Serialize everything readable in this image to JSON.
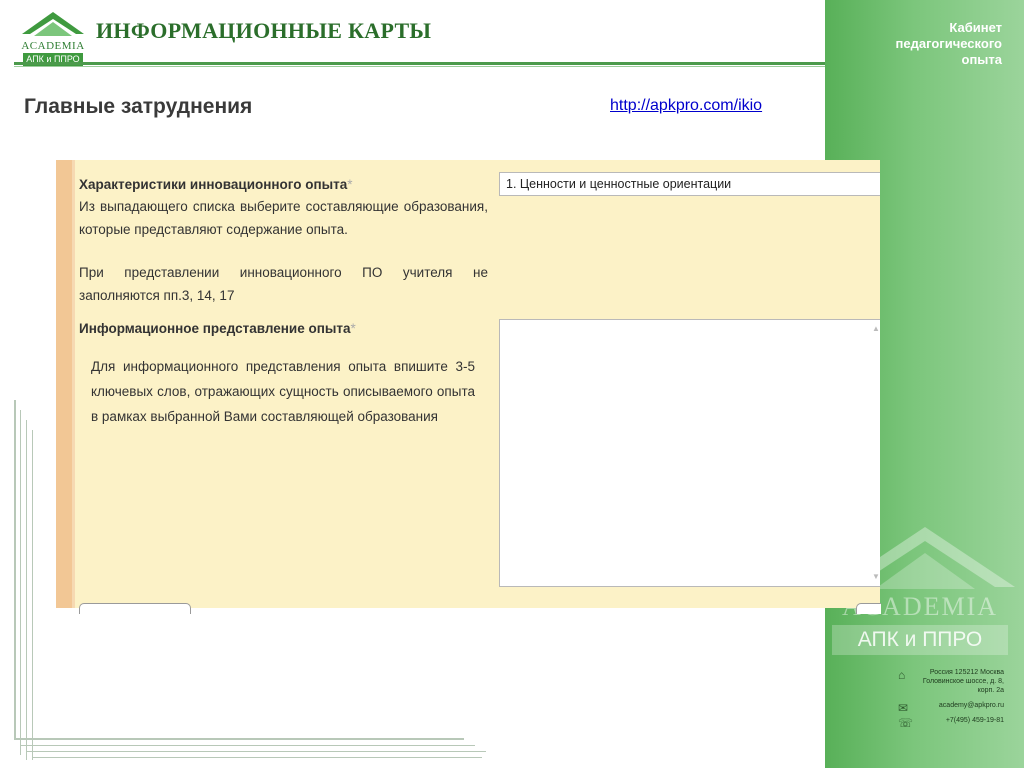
{
  "header": {
    "logo_academia": "ACADEMIA",
    "logo_apk": "АПК и ППРО",
    "title": "ИНФОРМАЦИОННЫЕ КАРТЫ"
  },
  "side_panel": {
    "caption_line1": "Кабинет",
    "caption_line2": "педагогического",
    "caption_line3": "опыта",
    "logo_academia": "ACADEMIA",
    "logo_apk": "АПК и ППРО",
    "address": "Россия 125212 Москва Головинское шоссе, д. 8, корп. 2а",
    "email": "academy@apkpro.ru",
    "phone": "+7(495) 459-19-81"
  },
  "page": {
    "title": "Главные затруднения",
    "link": "http://apkpro.com/ikio"
  },
  "form": {
    "field1_title": "Характеристики инновационного опыта",
    "required_mark": "*",
    "field1_desc1": "Из выпадающего списка выберите составляющие образования, которые представляют содержание опыта.",
    "field1_desc2": "При представлении инновационного ПО учителя не заполняются пп.3, 14, 17",
    "field1_value": "1. Ценности и ценностные ориентации",
    "field2_title": "Информационное представление опыта",
    "field2_hint": "Для информационного представления опыта впишите 3-5 ключевых слов, отражающих сущность описываемого опыта в рамках выбранной Вами составляющей образования"
  }
}
